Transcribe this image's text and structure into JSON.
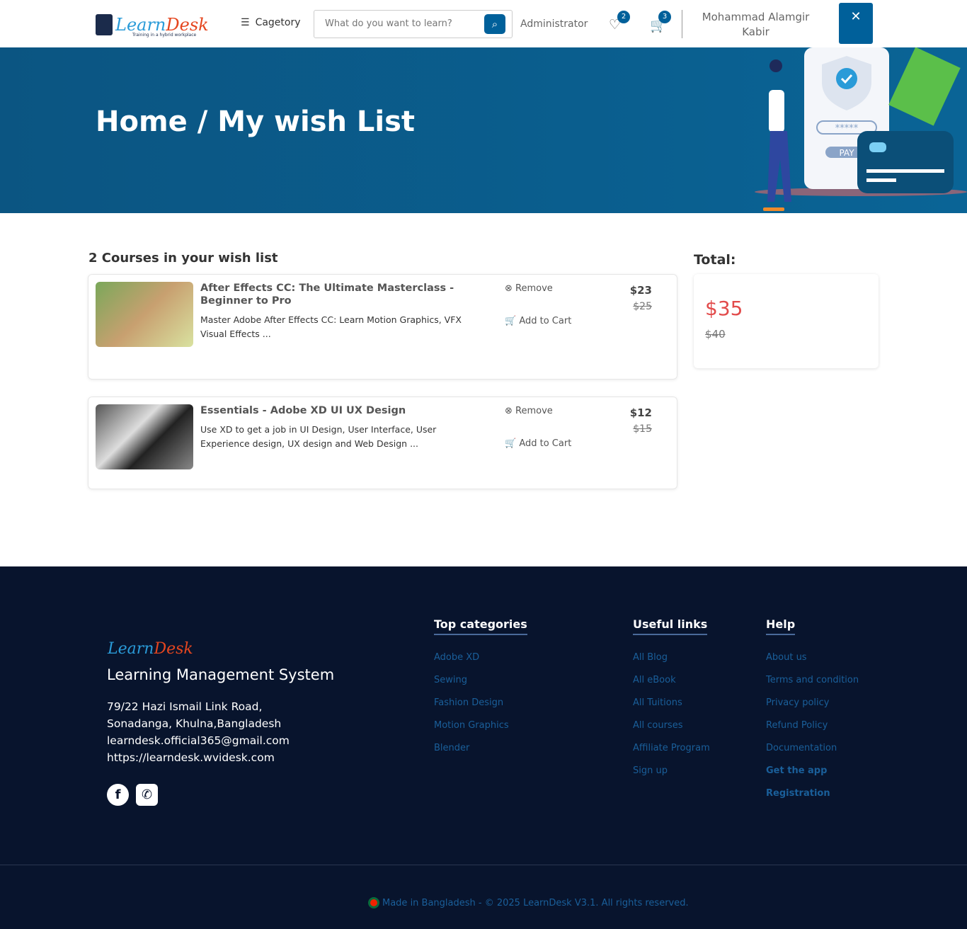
{
  "header": {
    "logo_text_a": "Learn",
    "logo_text_b": "Desk",
    "logo_tagline": "Training in a hybrid workplace",
    "category_label": "Cagetory",
    "search_placeholder": "What do you want to learn?",
    "admin_label": "Administrator",
    "wishlist_count": "2",
    "cart_count": "3",
    "user_name": "Mohammad Alamgir Kabir",
    "close_label": "✕"
  },
  "hero": {
    "title": "Home / My wish List",
    "illustration_pay": "PAY",
    "illustration_pw": "*****"
  },
  "wishlist": {
    "heading": "2 Courses in your wish list",
    "remove_label": "Remove",
    "add_cart_label": "Add to Cart",
    "items": [
      {
        "title": "After Effects CC: The Ultimate Masterclass - Beginner to Pro",
        "desc": "Master Adobe After Effects CC: Learn Motion Graphics, VFX Visual Effects ...",
        "price": "$23",
        "old_price": "$25"
      },
      {
        "title": "Essentials - Adobe XD UI UX Design",
        "desc": "Use XD to get a job in UI Design, User Interface, User Experience design, UX design and Web Design ...",
        "price": "$12",
        "old_price": "$15"
      }
    ]
  },
  "total": {
    "heading": "Total:",
    "price": "$35",
    "old_price": "$40"
  },
  "footer": {
    "title": "Learning Management System",
    "address": "79/22 Hazi Ismail Link Road, Sonadanga, Khulna,Bangladesh",
    "email": "learndesk.official365@gmail.com",
    "website": "https://learndesk.wvidesk.com",
    "columns": [
      {
        "title": "Top categories",
        "links": [
          "Adobe XD",
          "Sewing",
          "Fashion Design",
          "Motion Graphics",
          "Blender"
        ]
      },
      {
        "title": "Useful links",
        "links": [
          "All Blog",
          "All eBook",
          "All Tuitions",
          "All courses",
          "Affiliate Program",
          "Sign up"
        ]
      },
      {
        "title": "Help",
        "links": [
          "About us",
          "Terms and condition",
          "Privacy policy",
          "Refund Policy",
          "Documentation",
          "Get the app",
          "Registration"
        ]
      }
    ],
    "copyright": "Made in Bangladesh - © 2025 LearnDesk V3.1. All rights reserved."
  }
}
